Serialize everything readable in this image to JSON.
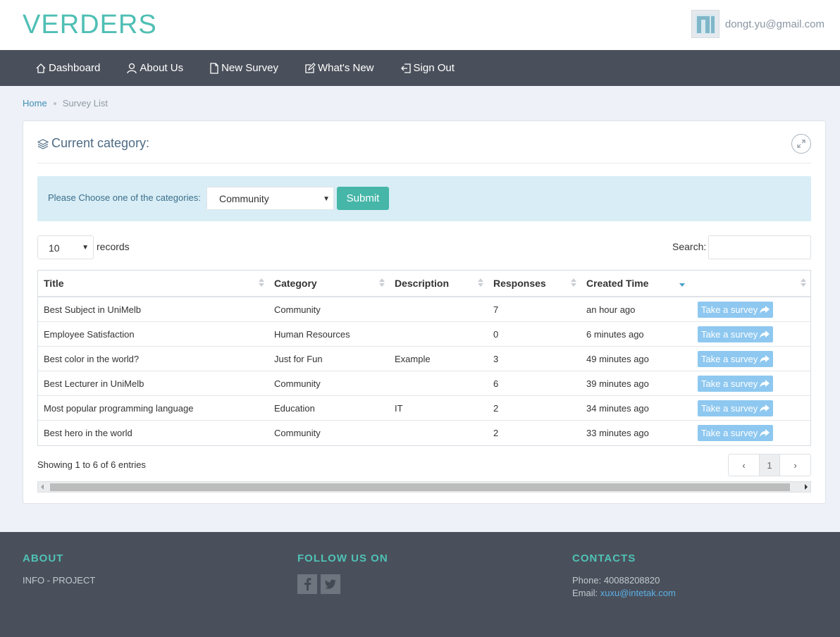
{
  "brand": "VERDERS",
  "user": {
    "email": "dongt.yu@gmail.com"
  },
  "nav": {
    "dashboard": "Dashboard",
    "about": "About Us",
    "new_survey": "New Survey",
    "whats_new": "What's New",
    "sign_out": "Sign Out"
  },
  "breadcrumb": {
    "home": "Home",
    "current": "Survey List"
  },
  "panel": {
    "title": "Current category:",
    "choose_label": "Please Choose one of the categories:",
    "category_selected": "Community",
    "submit": "Submit"
  },
  "table_controls": {
    "records_value": "10",
    "records_label": "records",
    "search_label": "Search:"
  },
  "table": {
    "headers": [
      "Title",
      "Category",
      "Description",
      "Responses",
      "Created Time",
      ""
    ],
    "rows": [
      {
        "title": "Best Subject in UniMelb",
        "category": "Community",
        "description": "",
        "responses": "7",
        "created": "an hour ago",
        "action": "Take a survey"
      },
      {
        "title": "Employee Satisfaction",
        "category": "Human Resources",
        "description": "",
        "responses": "0",
        "created": "6 minutes ago",
        "action": "Take a survey"
      },
      {
        "title": "Best color in the world?",
        "category": "Just for Fun",
        "description": "Example",
        "responses": "3",
        "created": "49 minutes ago",
        "action": "Take a survey"
      },
      {
        "title": "Best Lecturer in UniMelb",
        "category": "Community",
        "description": "",
        "responses": "6",
        "created": "39 minutes ago",
        "action": "Take a survey"
      },
      {
        "title": "Most popular programming language",
        "category": "Education",
        "description": "IT",
        "responses": "2",
        "created": "34 minutes ago",
        "action": "Take a survey"
      },
      {
        "title": "Best hero in the world",
        "category": "Community",
        "description": "",
        "responses": "2",
        "created": "33 minutes ago",
        "action": "Take a survey"
      }
    ],
    "showing": "Showing 1 to 6 of 6 entries",
    "page": "1"
  },
  "footer": {
    "about_head": "ABOUT",
    "about_text": "INFO - PROJECT",
    "follow_head": "FOLLOW US ON",
    "contacts_head": "CONTACTS",
    "phone": "Phone: 40088208820",
    "email_label": "Email: ",
    "email": "xuxu@intetak.com"
  },
  "colors": {
    "brand": "#4fbfb4",
    "navbar": "#4a505b",
    "submit": "#45b6a8",
    "take_survey": "#8ec8f0",
    "link": "#3d8fb5"
  },
  "icons": [
    "home-icon",
    "user-icon",
    "file-icon",
    "edit-icon",
    "sign-out-icon",
    "layers-icon",
    "expand-icon",
    "share-icon",
    "facebook-icon",
    "twitter-icon"
  ]
}
